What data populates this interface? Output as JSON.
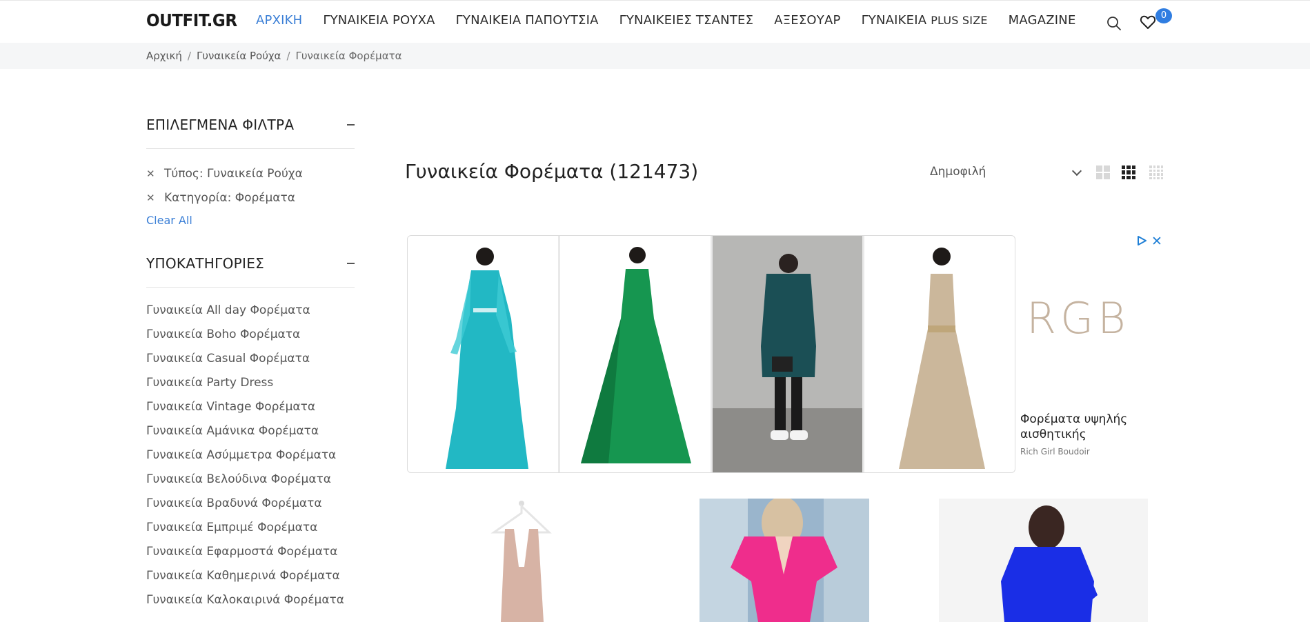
{
  "header": {
    "logo": "OUTFIT.GR",
    "nav": [
      "ΑΡΧΙΚΗ",
      "ΓΥΝΑΙΚΕΙΑ ΡΟΥΧΑ",
      "ΓΥΝΑΙΚΕΙΑ ΠΑΠΟΥΤΣΙΑ",
      "ΓΥΝΑΙΚΕΙΕΣ ΤΣΑΝΤΕΣ",
      "ΑΞΕΣΟΥΑΡ"
    ],
    "nav_plus_prefix": "ΓΥΝΑΙΚΕΙΑ",
    "nav_plus_suffix": "PLUS SIZE",
    "nav_magazine": "MAGAZINE",
    "wishlist_count": "0",
    "icons": [
      "search-icon",
      "heart-icon"
    ],
    "accent": "#3b7fd6"
  },
  "breadcrumb": [
    "Αρχική",
    "Γυναικεία Ρούχα",
    "Γυναικεία Φορέματα"
  ],
  "sidebar": {
    "selected_title": "ΕΠΙΛΕΓΜΕΝΑ ΦΙΛΤΡΑ",
    "filters": [
      "Τύπος: Γυναικεία Ρούχα",
      "Κατηγορία: Φορέματα"
    ],
    "clear_all": "Clear All",
    "subcategories_title": "ΥΠΟΚΑΤΗΓΟΡΙΕΣ",
    "subcategories": [
      "Γυναικεία All day Φορέματα",
      "Γυναικεία Boho Φορέματα",
      "Γυναικεία Casual Φορέματα",
      "Γυναικεία Party Dress",
      "Γυναικεία Vintage Φορέματα",
      "Γυναικεία Αμάνικα Φορέματα",
      "Γυναικεία Ασύμμετρα Φορέματα",
      "Γυναικεία Βελούδινα Φορέματα",
      "Γυναικεία Βραδυνά Φορέματα",
      "Γυναικεία Εμπριμέ Φορέματα",
      "Γυναικεία Εφαρμοστά Φορέματα",
      "Γυναικεία Καθημερινά Φορέματα",
      "Γυναικεία Καλοκαιρινά Φορέματα"
    ]
  },
  "main": {
    "title": "Γυναικεία Φορέματα (121473)",
    "sort_selected": "Δημοφιλή"
  },
  "ad": {
    "logo": "RGB",
    "headline": "Φορέματα υψηλής αισθητικής",
    "brand": "Rich Girl Boudoir",
    "product_colors": [
      "#22b8c4",
      "#169650",
      "#1b4f55",
      "#cbb79b"
    ]
  }
}
